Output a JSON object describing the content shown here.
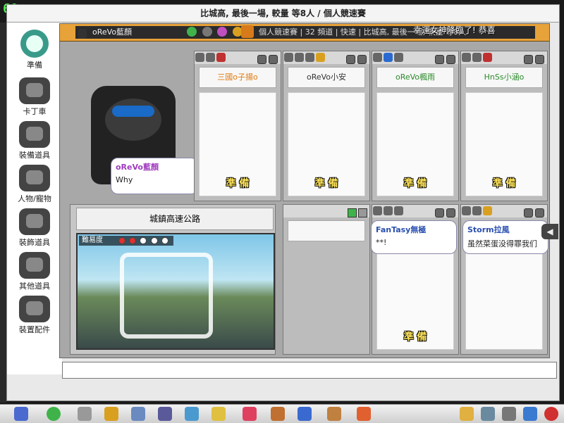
{
  "fps": "60",
  "title": "比城高, 最後一場, 較量 等8人 / 個人競速賽",
  "sidebar": {
    "items": [
      {
        "label": "準備",
        "icon": "ready-icon"
      },
      {
        "label": "卡丁車",
        "icon": "kart-icon"
      },
      {
        "label": "裝備道具",
        "icon": "equipment-icon"
      },
      {
        "label": "人物/寵物",
        "icon": "character-pet-icon"
      },
      {
        "label": "裝飾道具",
        "icon": "decoration-icon"
      },
      {
        "label": "其他道具",
        "icon": "other-items-icon"
      },
      {
        "label": "裝置配件",
        "icon": "accessory-icon"
      }
    ]
  },
  "infobar": {
    "player": "oReVo藍顏",
    "room": "個人競速賽 | 32 頻道 | 快速 | 比城高, 最後一場, 較量 等8人"
  },
  "announcement": "幸運女神降臨了! 恭喜",
  "host_bubble": {
    "name": "oReVo藍顏",
    "text": "Why"
  },
  "slots": [
    {
      "name": "三國o子揚o",
      "ready": "準 備",
      "name_color": "#e07a10"
    },
    {
      "name": "oReVo小安",
      "ready": "準 備",
      "name_color": "#333333"
    },
    {
      "name": "oReVo楓雨",
      "ready": "準 備",
      "name_color": "#2a8a2a"
    },
    {
      "name": "HnSs小涵o",
      "ready": "準 備",
      "name_color": "#2a8a2a"
    },
    {
      "name": "",
      "ready": ""
    },
    {
      "name": "",
      "ready": "準 備",
      "bubble_name": "FanTasy無極",
      "bubble_text": "**!"
    },
    {
      "name": "",
      "ready": "",
      "bubble_name": "Storm拉風",
      "bubble_text": "虽然菜蛋没得罪我们"
    }
  ],
  "track": {
    "name": "城鎮高速公路",
    "difficulty_label": "難易度",
    "difficulty_level": 2,
    "difficulty_max": 5
  },
  "chat": {
    "value": ""
  },
  "colors": {
    "accent": "#e8a23a",
    "ready": "#ffe45a"
  }
}
